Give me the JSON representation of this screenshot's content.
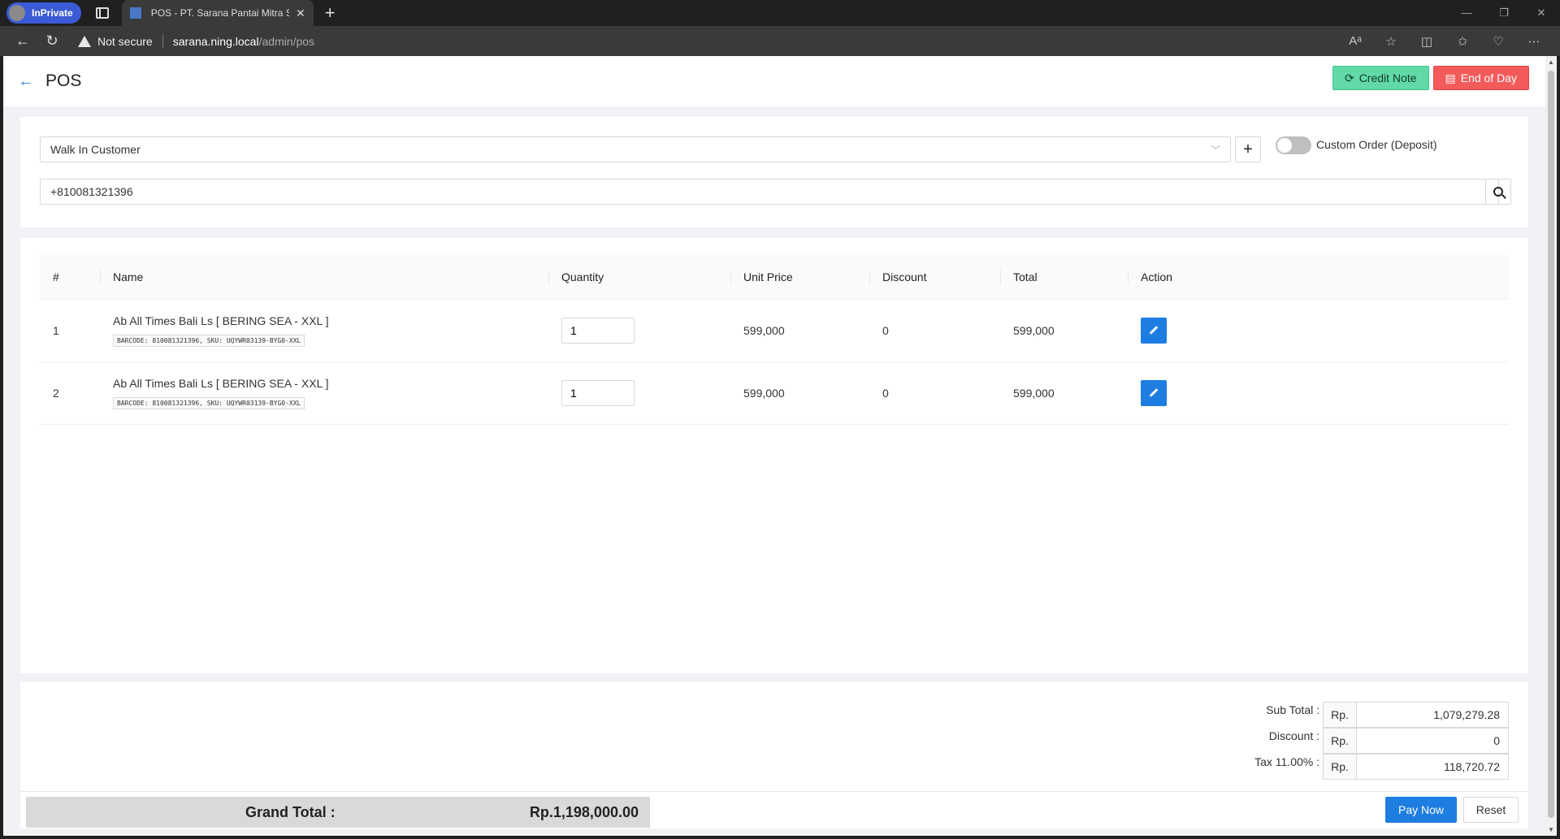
{
  "browser": {
    "inprivate_label": "InPrivate",
    "tab_title": "POS - PT. Sarana Pantai Mitra Se",
    "security_label": "Not secure",
    "url_host": "sarana.ning.local",
    "url_path": "/admin/pos"
  },
  "header": {
    "title": "POS",
    "credit_note_label": "Credit Note",
    "end_of_day_label": "End of Day"
  },
  "customer": {
    "selected": "Walk In Customer",
    "custom_order_label": "Custom Order (Deposit)",
    "custom_order_enabled": false,
    "barcode_value": "+810081321396"
  },
  "table": {
    "columns": [
      "#",
      "Name",
      "Quantity",
      "Unit Price",
      "Discount",
      "Total",
      "Action"
    ],
    "rows": [
      {
        "no": "1",
        "name": "Ab All Times Bali Ls [ BERING SEA - XXL ]",
        "tag": "BARCODE: 810081321396, SKU: UQYWR03139-BYG0-XXL",
        "qty": "1",
        "unit_price": "599,000",
        "discount": "0",
        "total": "599,000"
      },
      {
        "no": "2",
        "name": "Ab All Times Bali Ls [ BERING SEA - XXL ]",
        "tag": "BARCODE: 810081321396, SKU: UQYWR03139-BYG0-XXL",
        "qty": "1",
        "unit_price": "599,000",
        "discount": "0",
        "total": "599,000"
      }
    ]
  },
  "summary": {
    "subtotal_label": "Sub Total :",
    "discount_label": "Discount :",
    "tax_label": "Tax 11.00% :",
    "currency": "Rp.",
    "subtotal": "1,079,279.28",
    "discount": "0",
    "tax": "118,720.72",
    "grand_total_label": "Grand Total :",
    "grand_total": "Rp.1,198,000.00",
    "pay_now_label": "Pay Now",
    "reset_label": "Reset"
  }
}
